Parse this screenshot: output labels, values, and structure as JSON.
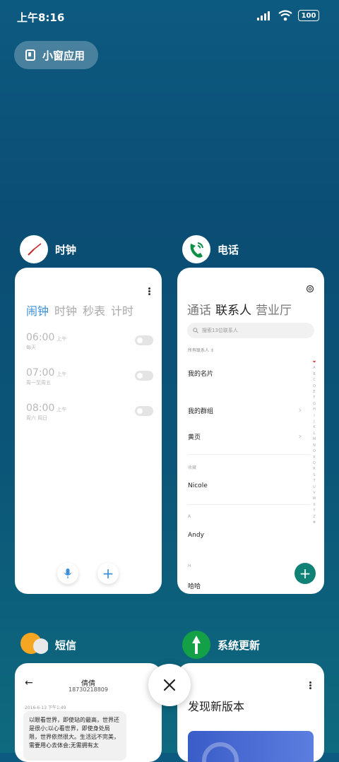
{
  "status": {
    "time": "上午8:16",
    "battery": "100"
  },
  "float_window": {
    "label": "小窗应用"
  },
  "apps": {
    "clock": {
      "name": "时钟",
      "tabs": [
        "闹钟",
        "时钟",
        "秒表",
        "计时"
      ],
      "alarms": [
        {
          "time": "06:00",
          "ampm": "上午",
          "repeat": "每天"
        },
        {
          "time": "07:00",
          "ampm": "上午",
          "repeat": "周一至周五"
        },
        {
          "time": "08:00",
          "ampm": "上午",
          "repeat": "周六 周日"
        }
      ]
    },
    "phone": {
      "name": "电话",
      "tabs": [
        "通话",
        "联系人",
        "营业厅"
      ],
      "search_placeholder": "搜索13位联系人",
      "filter": "所有联系人",
      "my_card": "我的名片",
      "my_groups": "我的群组",
      "yellow_pages": "黄页",
      "section_fav": "收藏",
      "contact_1": "Nicole",
      "section_a": "A",
      "contact_2": "Andy",
      "section_h": "H",
      "contact_3": "哈哈",
      "alphabet": [
        "❤",
        "A",
        "B",
        "C",
        "D",
        "E",
        "F",
        "G",
        "H",
        "I",
        "J",
        "K",
        "L",
        "M",
        "N",
        "O",
        "P",
        "Q",
        "R",
        "S",
        "T",
        "U",
        "V",
        "W",
        "X",
        "Y",
        "Z",
        "#"
      ]
    },
    "sms": {
      "name": "短信",
      "contact": "倩倩",
      "number": "18730218809",
      "date": "2016-6-13 下午1:49",
      "message": "以眼看世界，即使站的最高，世界还是很小;以心看世界，即使身处局限，世界依然很大。生活远不完美，需要用心去体会;无需拥有太"
    },
    "update": {
      "name": "系统更新",
      "title": "发现新版本"
    }
  },
  "colors": {
    "accent_blue": "#3b8fd9",
    "teal": "#0f8275"
  }
}
